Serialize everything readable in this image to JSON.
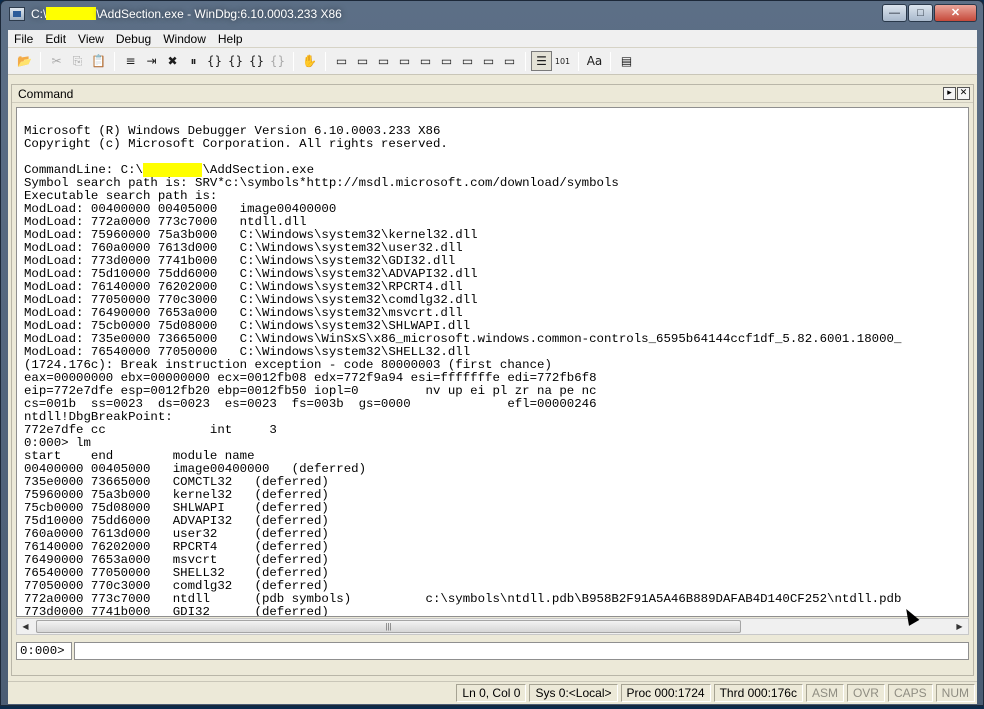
{
  "window": {
    "title_prefix": "C:\\",
    "title_suffix": "\\AddSection.exe - WinDbg:6.10.0003.233 X86",
    "minimize": "—",
    "maximize": "□",
    "close": "✕"
  },
  "menu": [
    "File",
    "Edit",
    "View",
    "Debug",
    "Window",
    "Help"
  ],
  "toolbar": {
    "icons": [
      "open-icon",
      "cut-icon",
      "copy-icon",
      "paste-icon",
      "go-icon",
      "restart-icon",
      "stop-debugging-icon",
      "break-icon",
      "step-into-icon",
      "step-over-icon",
      "step-out-icon",
      "run-to-cursor-icon",
      "hand-icon",
      "command-window-icon",
      "watch-window-icon",
      "locals-window-icon",
      "registers-window-icon",
      "memory-window-icon",
      "call-stack-icon",
      "disassembly-icon",
      "scratch-pad-icon",
      "processes-threads-icon",
      "source-mode-icon",
      "hex-mode-icon",
      "font-icon",
      "options-icon"
    ],
    "glyphs": [
      "📂",
      "✂",
      "⎘",
      "📋",
      "≡",
      "⇥",
      "✖",
      "⏸",
      "{}",
      "{}",
      "{}",
      "{}",
      "✋",
      "▭",
      "▭",
      "▭",
      "▭",
      "▭",
      "▭",
      "▭",
      "▭",
      "▭",
      "☰",
      "101",
      "Aa",
      "▤"
    ]
  },
  "command": {
    "title": "Command",
    "prompt": "0:000>",
    "input_value": "",
    "output_lines": [
      "",
      "Microsoft (R) Windows Debugger Version 6.10.0003.233 X86",
      "Copyright (c) Microsoft Corporation. All rights reserved.",
      "",
      "CommandLine: C:\\        \\AddSection.exe",
      "Symbol search path is: SRV*c:\\symbols*http://msdl.microsoft.com/download/symbols",
      "Executable search path is:",
      "ModLoad: 00400000 00405000   image00400000",
      "ModLoad: 772a0000 773c7000   ntdll.dll",
      "ModLoad: 75960000 75a3b000   C:\\Windows\\system32\\kernel32.dll",
      "ModLoad: 760a0000 7613d000   C:\\Windows\\system32\\user32.dll",
      "ModLoad: 773d0000 7741b000   C:\\Windows\\system32\\GDI32.dll",
      "ModLoad: 75d10000 75dd6000   C:\\Windows\\system32\\ADVAPI32.dll",
      "ModLoad: 76140000 76202000   C:\\Windows\\system32\\RPCRT4.dll",
      "ModLoad: 77050000 770c3000   C:\\Windows\\system32\\comdlg32.dll",
      "ModLoad: 76490000 7653a000   C:\\Windows\\system32\\msvcrt.dll",
      "ModLoad: 75cb0000 75d08000   C:\\Windows\\system32\\SHLWAPI.dll",
      "ModLoad: 735e0000 73665000   C:\\Windows\\WinSxS\\x86_microsoft.windows.common-controls_6595b64144ccf1df_5.82.6001.18000_",
      "ModLoad: 76540000 77050000   C:\\Windows\\system32\\SHELL32.dll",
      "(1724.176c): Break instruction exception - code 80000003 (first chance)",
      "eax=00000000 ebx=00000000 ecx=0012fb08 edx=772f9a94 esi=fffffffe edi=772fb6f8",
      "eip=772e7dfe esp=0012fb20 ebp=0012fb50 iopl=0         nv up ei pl zr na pe nc",
      "cs=001b  ss=0023  ds=0023  es=0023  fs=003b  gs=0000             efl=00000246",
      "ntdll!DbgBreakPoint:",
      "772e7dfe cc              int     3",
      "0:000> lm",
      "start    end        module name",
      "00400000 00405000   image00400000   (deferred)",
      "735e0000 73665000   COMCTL32   (deferred)",
      "75960000 75a3b000   kernel32   (deferred)",
      "75cb0000 75d08000   SHLWAPI    (deferred)",
      "75d10000 75dd6000   ADVAPI32   (deferred)",
      "760a0000 7613d000   user32     (deferred)",
      "76140000 76202000   RPCRT4     (deferred)",
      "76490000 7653a000   msvcrt     (deferred)",
      "76540000 77050000   SHELL32    (deferred)",
      "77050000 770c3000   comdlg32   (deferred)",
      "772a0000 773c7000   ntdll      (pdb symbols)          c:\\symbols\\ntdll.pdb\\B958B2F91A5A46B889DAFAB4D140CF252\\ntdll.pdb",
      "773d0000 7741b000   GDI32      (deferred)"
    ]
  },
  "status": {
    "ln_col": "Ln 0, Col 0",
    "sys": "Sys 0:<Local>",
    "proc": "Proc 000:1724",
    "thrd": "Thrd 000:176c",
    "asm": "ASM",
    "ovr": "OVR",
    "caps": "CAPS",
    "num": "NUM"
  }
}
